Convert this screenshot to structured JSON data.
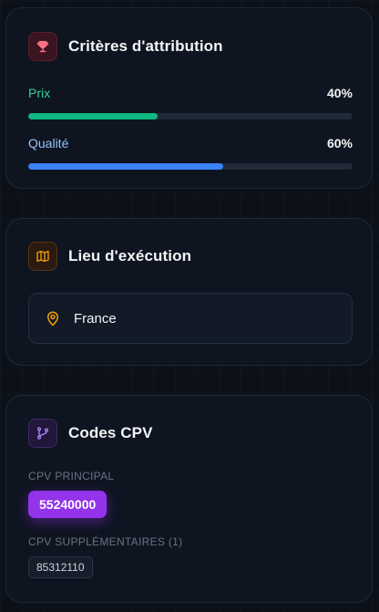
{
  "criteria": {
    "title": "Critères d'attribution",
    "icon": "trophy-icon",
    "items": [
      {
        "label": "Prix",
        "percent_text": "40%",
        "value": 40,
        "color": "#10b981"
      },
      {
        "label": "Qualité",
        "percent_text": "60%",
        "value": 60,
        "color": "#3b82f6"
      }
    ]
  },
  "location": {
    "title": "Lieu d'exécution",
    "icon": "map-icon",
    "place_icon": "map-pin-icon",
    "place": "France"
  },
  "cpv": {
    "title": "Codes CPV",
    "icon": "git-branch-icon",
    "principal_label": "CPV PRINCIPAL",
    "principal_code": "55240000",
    "supplementary_label": "CPV SUPPLÉMENTAIRES (1)",
    "supplementary_codes": [
      "85312110"
    ]
  },
  "colors": {
    "accent_purple": "#9333ea",
    "green": "#10b981",
    "blue": "#3b82f6",
    "orange": "#f59e0b",
    "pink": "#fb7185"
  }
}
